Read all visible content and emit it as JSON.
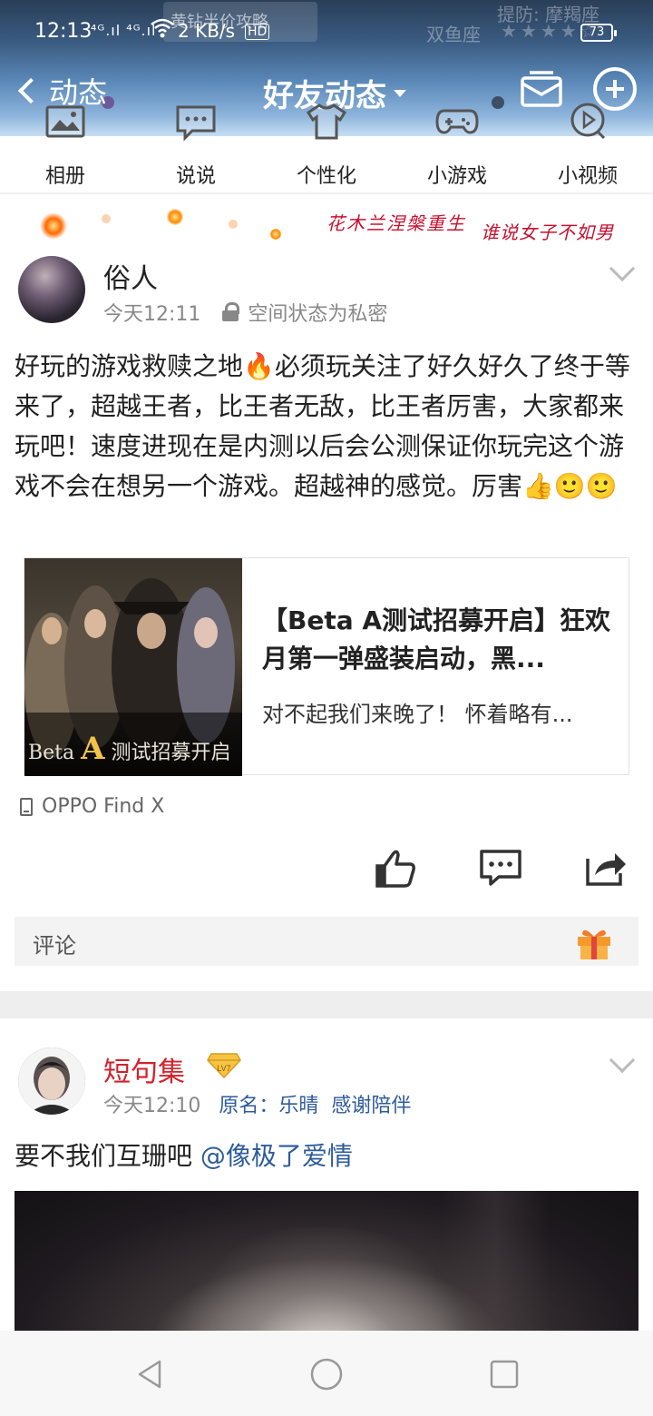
{
  "status_bar": {
    "time": "12:13",
    "signal": "⁴ᴳ.ıl ⁴ᴳ.ıl",
    "speed": "2 KB/s",
    "hd": "HD",
    "battery": "73"
  },
  "header_background": {
    "ad_text": "黄钻半价攻略",
    "text_1": "提防: 摩羯座",
    "text_2": "双鱼座",
    "stars": "★★★★☆"
  },
  "header": {
    "back_label": "动态",
    "title": "好友动态"
  },
  "quick_nav": [
    {
      "label": "相册",
      "icon": "photo-album-icon"
    },
    {
      "label": "说说",
      "icon": "speech-bubble-icon"
    },
    {
      "label": "个性化",
      "icon": "tshirt-icon"
    },
    {
      "label": "小游戏",
      "icon": "gamepad-icon"
    },
    {
      "label": "小视频",
      "icon": "video-play-icon"
    }
  ],
  "banner": {
    "text_1": "花木兰涅槃重生",
    "text_2": "谁说女子不如男"
  },
  "posts": [
    {
      "author": "俗人",
      "time": "今天12:11",
      "privacy": "空间状态为私密",
      "text": "好玩的游戏救赎之地🔥必须玩关注了好久好久了终于等来了，超越王者，比王者无敌，比王者厉害，大家都来玩吧！速度进现在是内测以后会公测保证你玩完这个游戏不会在想另一个游戏。超越神的感觉。厉害👍🙂🙂",
      "link_card": {
        "image_caption_prefix": "Beta",
        "image_caption_a": "A",
        "image_caption_suffix": "测试招募开启",
        "title": "【Beta A测试招募开启】狂欢月第一弹盛装启动，黑...",
        "description": "对不起我们来晚了！ 怀着略有..."
      },
      "device": "OPPO Find X",
      "comment_placeholder": "评论"
    },
    {
      "author": "短句集",
      "level_badge": "LV7",
      "time": "今天12:10",
      "origin_label": "原名：乐晴",
      "origin_extra": "感谢陪伴⁡",
      "text_prefix": "要不我们互珊吧",
      "mention": "@像极了爱情"
    }
  ],
  "colors": {
    "link_blue": "#2d5b9b",
    "author_red": "#d3212a",
    "header_top": "#2a3e57",
    "header_bottom": "#c7dff2"
  }
}
